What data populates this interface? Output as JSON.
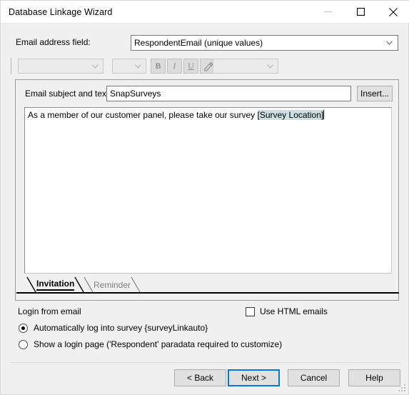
{
  "window": {
    "title": "Database Linkage Wizard",
    "controls": {
      "minimize": "minimize-icon",
      "maximize": "maximize-icon",
      "close": "close-icon"
    }
  },
  "email_field_row": {
    "label": "Email address field:",
    "selected": "RespondentEmail (unique values)"
  },
  "toolbar": {
    "font_name": "",
    "font_size": "",
    "bold": "B",
    "italic": "I",
    "underline": "U",
    "highlight": "highlighter-icon",
    "style": ""
  },
  "message_panel": {
    "subject_label": "Email subject and text:",
    "subject_value": "SnapSurveys",
    "insert_button": "Insert...",
    "body_text_before": "As a member of our customer panel, please take our survey ",
    "body_token": "[Survey Location]",
    "tabs": [
      {
        "label": "Invitation",
        "active": true
      },
      {
        "label": "Reminder",
        "active": false
      }
    ]
  },
  "options": {
    "group_label": "Login from email",
    "radios": [
      {
        "label": "Automatically log into survey {surveyLinkauto}",
        "checked": true
      },
      {
        "label": "Show a login page ('Respondent' paradata required to customize)",
        "checked": false
      }
    ],
    "checkbox": {
      "label": "Use HTML emails",
      "checked": false
    }
  },
  "footer": {
    "buttons": [
      {
        "label": "< Back",
        "default": false
      },
      {
        "label": "Next >",
        "default": true
      },
      {
        "label": "Cancel",
        "default": false
      },
      {
        "label": "Help",
        "default": false
      }
    ]
  },
  "colors": {
    "dialog_background": "#f0f0f0",
    "titlebar_background": "#ffffff",
    "field_background": "#ffffff",
    "token_highlight": "#cddfe2",
    "focus_border": "#0078d7",
    "disabled_text": "#8c8c8c"
  }
}
